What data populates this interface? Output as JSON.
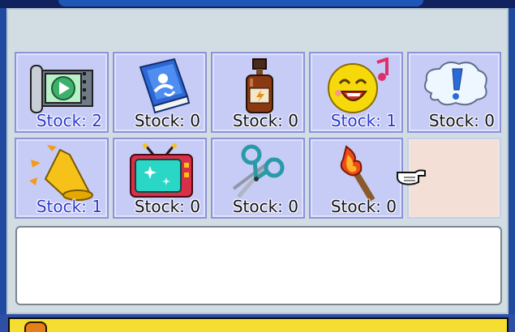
{
  "inventory": {
    "items": [
      {
        "id": "video",
        "icon": "film-play-icon",
        "stock_text": "Stock: 2",
        "stock": 2
      },
      {
        "id": "book",
        "icon": "blue-book-icon",
        "stock_text": "Stock: 0",
        "stock": 0
      },
      {
        "id": "potion",
        "icon": "potion-bottle-icon",
        "stock_text": "Stock: 0",
        "stock": 0
      },
      {
        "id": "happy",
        "icon": "singing-smiley-icon",
        "stock_text": "Stock: 1",
        "stock": 1
      },
      {
        "id": "alert",
        "icon": "exclamation-cloud-icon",
        "stock_text": "Stock: 0",
        "stock": 0
      },
      {
        "id": "megaphone",
        "icon": "megaphone-icon",
        "stock_text": "Stock: 1",
        "stock": 1
      },
      {
        "id": "tv",
        "icon": "tv-icon",
        "stock_text": "Stock: 0",
        "stock": 0
      },
      {
        "id": "scissors",
        "icon": "scissors-icon",
        "stock_text": "Stock: 0",
        "stock": 0
      },
      {
        "id": "torch",
        "icon": "torch-icon",
        "stock_text": "Stock: 0",
        "stock": 0
      }
    ]
  },
  "colors": {
    "panel_bg": "#d1dde3",
    "slot_bg": "#c7ccf7",
    "slot_border": "#8c93d9",
    "empty_slot_bg": "#f3dfd6",
    "stock_owned": "#2b38c8",
    "stock_none": "#111111",
    "bottom_bar": "#f6dd31"
  }
}
